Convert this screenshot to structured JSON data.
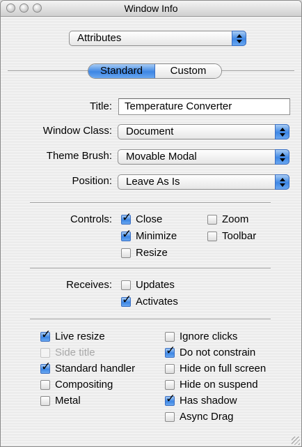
{
  "window": {
    "title": "Window Info"
  },
  "top_popup": {
    "value": "Attributes"
  },
  "tabs": [
    {
      "label": "Standard",
      "selected": true
    },
    {
      "label": "Custom",
      "selected": false
    }
  ],
  "fields": {
    "title_label": "Title:",
    "title_value": "Temperature Converter",
    "window_class_label": "Window Class:",
    "window_class_value": "Document",
    "theme_brush_label": "Theme Brush:",
    "theme_brush_value": "Movable Modal",
    "position_label": "Position:",
    "position_value": "Leave As Is"
  },
  "controls": {
    "label": "Controls:",
    "items": [
      {
        "label": "Close",
        "checked": true
      },
      {
        "label": "Minimize",
        "checked": true
      },
      {
        "label": "Resize",
        "checked": false
      },
      {
        "label": "Zoom",
        "checked": false
      },
      {
        "label": "Toolbar",
        "checked": false
      }
    ]
  },
  "receives": {
    "label": "Receives:",
    "items": [
      {
        "label": "Updates",
        "checked": false
      },
      {
        "label": "Activates",
        "checked": true
      }
    ]
  },
  "options": {
    "left": [
      {
        "label": "Live resize",
        "checked": true,
        "enabled": true
      },
      {
        "label": "Side title",
        "checked": false,
        "enabled": false
      },
      {
        "label": "Standard handler",
        "checked": true,
        "enabled": true
      },
      {
        "label": "Compositing",
        "checked": false,
        "enabled": true
      },
      {
        "label": "Metal",
        "checked": false,
        "enabled": true
      }
    ],
    "right": [
      {
        "label": "Ignore clicks",
        "checked": false,
        "enabled": true
      },
      {
        "label": "Do not constrain",
        "checked": true,
        "enabled": true
      },
      {
        "label": "Hide on full screen",
        "checked": false,
        "enabled": true
      },
      {
        "label": "Hide on suspend",
        "checked": false,
        "enabled": true
      },
      {
        "label": "Has shadow",
        "checked": true,
        "enabled": true
      },
      {
        "label": "Async Drag",
        "checked": false,
        "enabled": true
      }
    ]
  }
}
